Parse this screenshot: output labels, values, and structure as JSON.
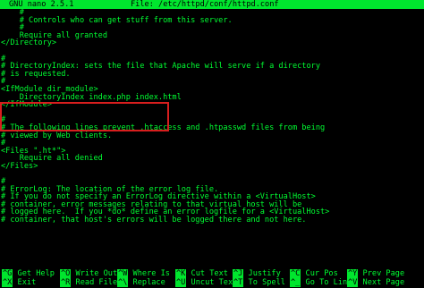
{
  "titlebar": {
    "app": "GNU nano 2.5.1",
    "file": "File: /etc/httpd/conf/httpd.conf"
  },
  "lines": [
    "    #",
    "    # Controls who can get stuff from this server.",
    "    #",
    "    Require all granted",
    "</Directory>",
    "",
    "#",
    "# DirectoryIndex: sets the file that Apache will serve if a directory",
    "# is requested.",
    "#",
    "<IfModule dir_module>",
    "    DirectoryIndex index.php index.html",
    "</IfModule>",
    "",
    "#",
    "# The following lines prevent .htaccess and .htpasswd files from being",
    "# viewed by Web clients.",
    "#",
    "<Files \".ht*\">",
    "    Require all denied",
    "</Files>",
    "",
    "#",
    "# ErrorLog: The location of the error log file.",
    "# If you do not specify an ErrorLog directive within a <VirtualHost>",
    "# container, error messages relating to that virtual host will be",
    "# logged here.  If you *do* define an error logfile for a <VirtualHost>",
    "# container, that host's errors will be logged there and not here."
  ],
  "shortcuts": {
    "row1": [
      {
        "key": "^G",
        "label": "Get Help"
      },
      {
        "key": "^O",
        "label": "Write Out"
      },
      {
        "key": "^W",
        "label": "Where Is"
      },
      {
        "key": "^K",
        "label": "Cut Text"
      },
      {
        "key": "^J",
        "label": "Justify"
      },
      {
        "key": "^C",
        "label": "Cur Pos"
      },
      {
        "key": "^Y",
        "label": "Prev Page"
      }
    ],
    "row2": [
      {
        "key": "^X",
        "label": "Exit"
      },
      {
        "key": "^R",
        "label": "Read File"
      },
      {
        "key": "^\\",
        "label": "Replace"
      },
      {
        "key": "^U",
        "label": "Uncut Text"
      },
      {
        "key": "^T",
        "label": "To Spell"
      },
      {
        "key": "^_",
        "label": "Go To Line"
      },
      {
        "key": "^V",
        "label": "Next Page"
      }
    ]
  },
  "colors": {
    "text": "#00ff32",
    "bar": "#00e62e",
    "background": "#000000",
    "highlight_border": "#d81e1e"
  }
}
